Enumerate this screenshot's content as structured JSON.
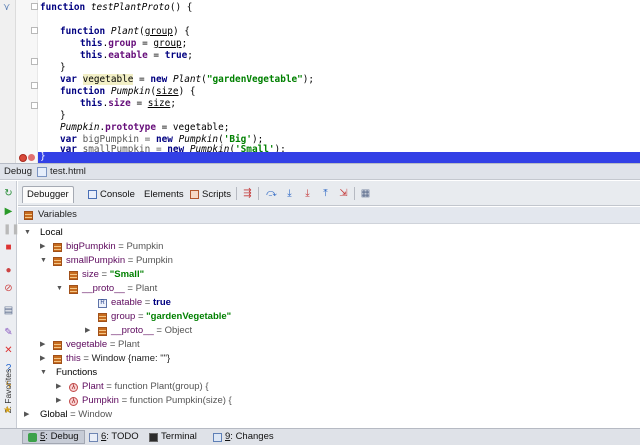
{
  "editor": {
    "lines": {
      "l0_kw": "function",
      "l0_name": "testPlantProto",
      "l0_rest": "() {",
      "l2_kw": "function",
      "l2_name": "Plant",
      "l2_open": "(",
      "l2_arg": "group",
      "l2_close": ") {",
      "l3_this": "this",
      "l3_dot": ".",
      "l3_field": "group",
      "l3_eq": " = ",
      "l3_val": "group",
      "l3_end": ";",
      "l4_this": "this",
      "l4_dot": ".",
      "l4_field": "eatable",
      "l4_eq": " = ",
      "l4_val": "true",
      "l4_end": ";",
      "l5": "}",
      "l6_kw": "var",
      "l6_name": "vegetable",
      "l6_eq": " = ",
      "l6_new": "new",
      "l6_cls": "Plant",
      "l6_open": "(",
      "l6_str": "\"gardenVegetable\"",
      "l6_end": ");",
      "l7_kw": "function",
      "l7_name": "Pumpkin",
      "l7_open": "(",
      "l7_arg": "size",
      "l7_close": ") {",
      "l8_this": "this",
      "l8_dot": ".",
      "l8_field": "size",
      "l8_eq": " = ",
      "l8_val": "size",
      "l8_end": ";",
      "l9": "}",
      "l10_cls": "Pumpkin",
      "l10_dot": ".",
      "l10_field": "prototype",
      "l10_rest": " = vegetable;",
      "l12_kw": "var",
      "l12_name": " bigPumpkin = ",
      "l12_new": "new",
      "l12_cls": "Pumpkin",
      "l12_open": "(",
      "l12_str": "'Big'",
      "l12_end": ");",
      "l13_kw": "var",
      "l13_name": " smallPumpkin = ",
      "l13_new": "new",
      "l13_cls": "Pumpkin",
      "l13_open": "(",
      "l13_str": "'Small'",
      "l13_end": ");",
      "l14": "}"
    }
  },
  "debug_header": {
    "title": "Debug",
    "file": "test.html"
  },
  "tabs": {
    "debugger": "Debugger",
    "console": "Console",
    "elements": "Elements",
    "scripts": "Scripts"
  },
  "variables": {
    "title": "Variables",
    "rows": {
      "local": "Local",
      "bigPumpkin_name": "bigPumpkin",
      "bigPumpkin_val": "Pumpkin",
      "smallPumpkin_name": "smallPumpkin",
      "smallPumpkin_val": "Pumpkin",
      "size_name": "size",
      "size_val": "\"Small\"",
      "proto_name": "__proto__",
      "proto_val": "Plant",
      "eatable_name": "eatable",
      "eatable_val": "true",
      "group_name": "group",
      "group_val": "\"gardenVegetable\"",
      "proto2_name": "__proto__",
      "proto2_val": "Object",
      "vegetable_name": "vegetable",
      "vegetable_val": "Plant",
      "this_name": "this",
      "this_val": "Window {name: \"\"}",
      "functions": "Functions",
      "plant_name": "Plant",
      "plant_val": "function Plant(group) {",
      "pumpkin_name": "Pumpkin",
      "pumpkin_val": "function Pumpkin(size) {",
      "global_name": "Global",
      "global_val": "Window"
    },
    "sep": " = "
  },
  "favorites_label": "2: Favorites",
  "bottom_tabs": {
    "debug_num": "5",
    "debug": ": Debug",
    "todo_num": "6",
    "todo": ": TODO",
    "terminal": "Terminal",
    "changes_num": "9",
    "changes": ": Changes"
  },
  "colors": {
    "current_line": "#3240e6",
    "breakpoint": "#d94a3a",
    "string": "#008000",
    "keyword": "#000080",
    "field": "#660e7a"
  }
}
